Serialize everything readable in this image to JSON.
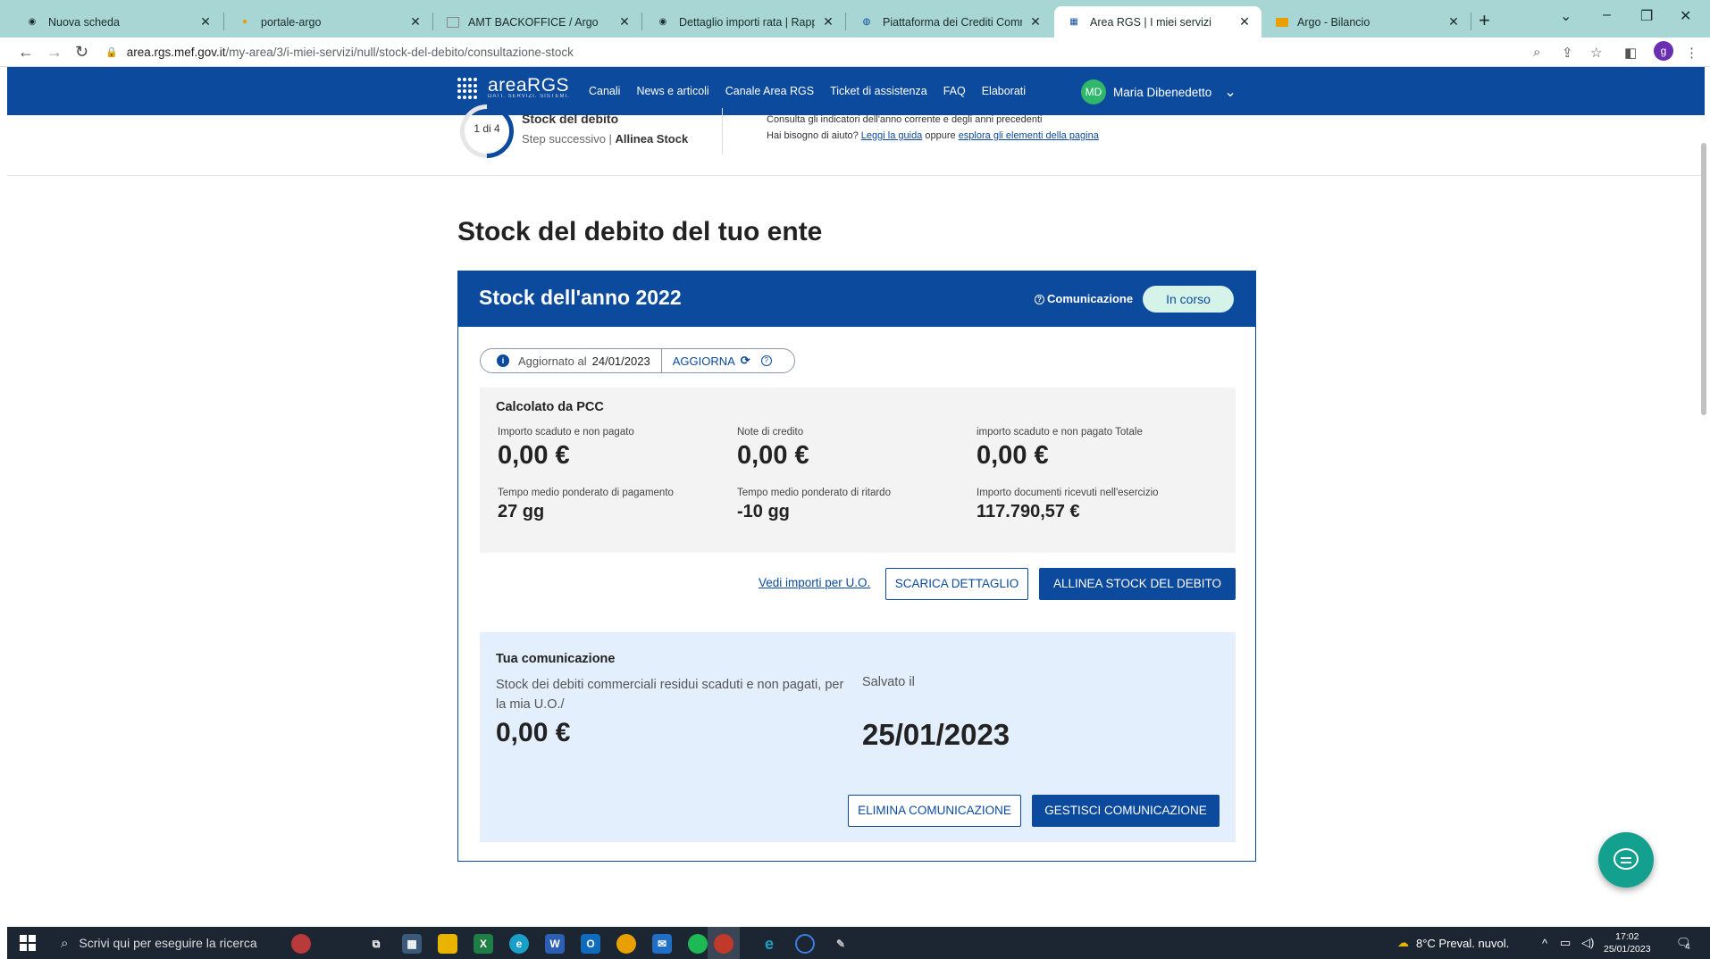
{
  "browser": {
    "tabs": [
      {
        "title": "Nuova scheda",
        "active": false
      },
      {
        "title": "portale-argo",
        "active": false
      },
      {
        "title": "AMT BACKOFFICE / Argo",
        "active": false
      },
      {
        "title": "Dettaglio importi rata | Rapporti",
        "active": false
      },
      {
        "title": "Piattaforma dei Crediti Commerc",
        "active": false
      },
      {
        "title": "Area RGS | I miei servizi",
        "active": true
      },
      {
        "title": "Argo - Bilancio",
        "active": false
      }
    ],
    "url_host": "area.rgs.mef.gov.it",
    "url_path": "/my-area/3/i-miei-servizi/null/stock-del-debito/consultazione-stock",
    "profile_initial": "g"
  },
  "header": {
    "logo": "areaRGS",
    "logo_sub": "DATI. SERVIZI. SISTEMI.",
    "menu": [
      "Canali",
      "News e articoli",
      "Canale Area RGS",
      "Ticket di assistenza",
      "FAQ",
      "Elaborati"
    ],
    "user_initials": "MD",
    "user_name": "Maria Dibenedetto"
  },
  "stepbar": {
    "step": "1 di 4",
    "title": "Stock del debito",
    "next_prefix": "Step successivo | ",
    "next_label": "Allinea Stock",
    "info_line1": "Consulta gli indicatori dell'anno corrente e degli anni precedenti",
    "info_line2_prefix": "Hai bisogno di aiuto? ",
    "info_link1": "Leggi la guida",
    "info_mid": " oppure ",
    "info_link2": "esplora gli elementi della pagina"
  },
  "main": {
    "page_title": "Stock del debito del tuo ente",
    "card_title": "Stock dell'anno 2022",
    "comunicazione_label": "Comunicazione",
    "status_badge": "In corso",
    "updated_label": "Aggiornato al",
    "updated_date": "24/01/2023",
    "refresh_label": "AGGIORNA",
    "pcc": {
      "title": "Calcolato da PCC",
      "metrics": [
        {
          "label": "Importo scaduto e non pagato",
          "value": "0,00 €"
        },
        {
          "label": "Note di credito",
          "value": "0,00 €"
        },
        {
          "label": "importo scaduto e non pagato Totale",
          "value": "0,00 €"
        },
        {
          "label": "Tempo medio ponderato di pagamento",
          "value": "27 gg"
        },
        {
          "label": "Tempo medio ponderato di ritardo",
          "value": "-10 gg"
        },
        {
          "label": "Importo documenti ricevuti nell'esercizio",
          "value": "117.790,57 €"
        }
      ]
    },
    "actions": {
      "link_uo": "Vedi importi per U.O.",
      "download": "SCARICA DETTAGLIO",
      "align": "ALLINEA STOCK DEL DEBITO"
    },
    "comunicazione": {
      "title": "Tua comunicazione",
      "description": "Stock dei debiti commerciali residui scaduti e non pagati, per la mia U.O./",
      "value": "0,00 €",
      "saved_label": "Salvato il",
      "saved_date": "25/01/2023",
      "delete": "ELIMINA COMUNICAZIONE",
      "manage": "GESTISCI COMUNICAZIONE"
    }
  },
  "taskbar": {
    "search_placeholder": "Scrivi qui per eseguire la ricerca",
    "weather": "8°C  Preval. nuvol.",
    "time": "17:02",
    "date": "25/01/2023",
    "notifications": "4"
  }
}
